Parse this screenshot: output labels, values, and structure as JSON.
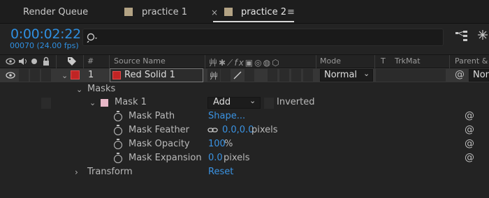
{
  "tabs": [
    {
      "label": "Render Queue"
    },
    {
      "label": "practice 1"
    },
    {
      "label": "practice 2"
    }
  ],
  "time": {
    "timecode": "0:00:02:22",
    "fps": "00070 (24.00 fps)"
  },
  "search": {
    "placeholder": ""
  },
  "columns": {
    "number": "#",
    "source_name": "Source Name",
    "mode": "Mode",
    "t": "T",
    "trkmat": "TrkMat",
    "parent": "Parent & L"
  },
  "layer": {
    "number": "1",
    "name": "Red Solid 1",
    "mode": "Normal",
    "parent": "Non"
  },
  "tree": {
    "masks": "Masks",
    "mask1": "Mask 1",
    "mask_mode": "Add",
    "inverted": "Inverted",
    "mask_path_label": "Mask Path",
    "mask_path_value": "Shape...",
    "mask_feather_label": "Mask Feather",
    "mask_feather_value": "0.0,0.0",
    "mask_feather_unit": "pixels",
    "mask_opacity_label": "Mask Opacity",
    "mask_opacity_value": "100",
    "mask_opacity_unit": "%",
    "mask_expansion_label": "Mask Expansion",
    "mask_expansion_value": "0.0",
    "mask_expansion_unit": "pixels",
    "transform_label": "Transform",
    "transform_value": "Reset"
  },
  "colors": {
    "accent_blue": "#2f8fe0",
    "layer_label_red": "#c12424",
    "mask_color_pink": "#e8b8c8",
    "comp_swatch": "#b3a384"
  }
}
